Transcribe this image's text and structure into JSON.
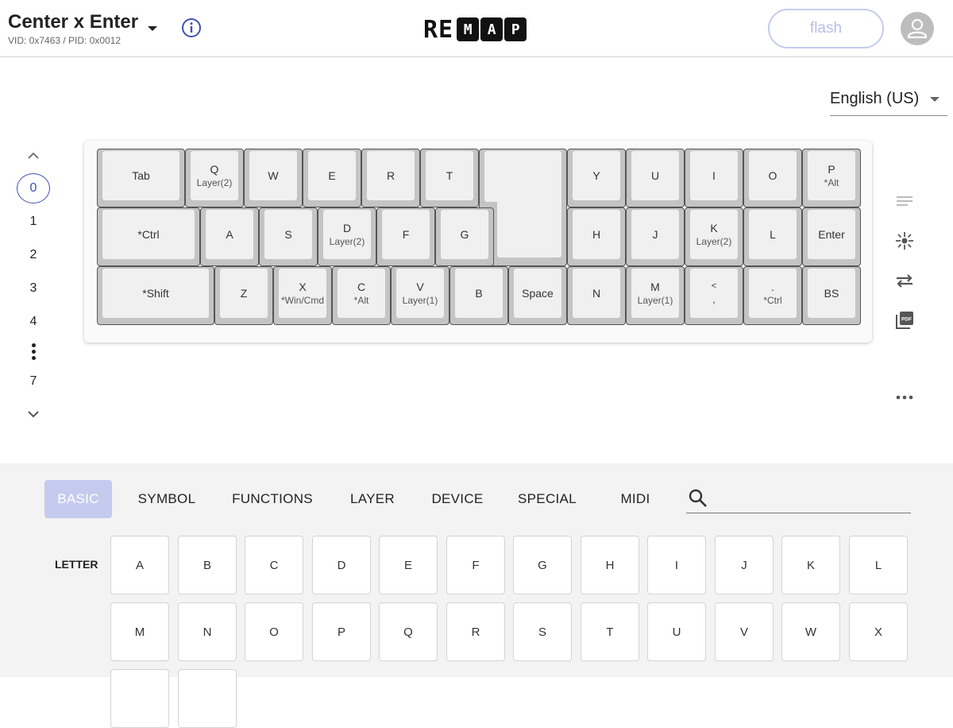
{
  "header": {
    "keyboard_name": "Center x Enter",
    "vid_pid": "VID: 0x7463 / PID: 0x0012",
    "logo_re": "RE",
    "logo_boxes": [
      "M",
      "A",
      "P"
    ],
    "flash_label": "flash"
  },
  "language": {
    "selected": "English (US)"
  },
  "layers": {
    "items": [
      "0",
      "1",
      "2",
      "3",
      "4",
      "7"
    ],
    "active": "0"
  },
  "keyboard": {
    "row1": [
      {
        "label": "Tab",
        "sub": ""
      },
      {
        "label": "Q",
        "sub": "Layer(2)"
      },
      {
        "label": "W",
        "sub": ""
      },
      {
        "label": "E",
        "sub": ""
      },
      {
        "label": "R",
        "sub": ""
      },
      {
        "label": "T",
        "sub": ""
      },
      {
        "label": "",
        "sub": ""
      },
      {
        "label": "Y",
        "sub": ""
      },
      {
        "label": "U",
        "sub": ""
      },
      {
        "label": "I",
        "sub": ""
      },
      {
        "label": "O",
        "sub": ""
      },
      {
        "label": "P",
        "sub": "*Alt"
      }
    ],
    "row2": [
      {
        "label": "*Ctrl",
        "sub": ""
      },
      {
        "label": "A",
        "sub": ""
      },
      {
        "label": "S",
        "sub": ""
      },
      {
        "label": "D",
        "sub": "Layer(2)"
      },
      {
        "label": "F",
        "sub": ""
      },
      {
        "label": "G",
        "sub": ""
      },
      {
        "label": "H",
        "sub": ""
      },
      {
        "label": "J",
        "sub": ""
      },
      {
        "label": "K",
        "sub": "Layer(2)"
      },
      {
        "label": "L",
        "sub": ""
      },
      {
        "label": "Enter",
        "sub": ""
      }
    ],
    "row3": [
      {
        "label": "*Shift",
        "sub": ""
      },
      {
        "label": "Z",
        "sub": ""
      },
      {
        "label": "X",
        "sub": "*Win/Cmd"
      },
      {
        "label": "C",
        "sub": "*Alt"
      },
      {
        "label": "V",
        "sub": "Layer(1)"
      },
      {
        "label": "B",
        "sub": ""
      },
      {
        "label": "Space",
        "sub": ""
      },
      {
        "label": "N",
        "sub": ""
      },
      {
        "label": "M",
        "sub": "Layer(1)"
      },
      {
        "label": "<",
        "sub": ","
      },
      {
        "label": ".",
        "sub": "*Ctrl"
      },
      {
        "label": "BS",
        "sub": ""
      }
    ]
  },
  "tabs": [
    "BASIC",
    "SYMBOL",
    "FUNCTIONS",
    "LAYER",
    "DEVICE",
    "SPECIAL",
    "MIDI"
  ],
  "active_tab": "BASIC",
  "search": {
    "placeholder": ""
  },
  "palette": {
    "section_label": "LETTER",
    "row1": [
      "A",
      "B",
      "C",
      "D",
      "E",
      "F",
      "G",
      "H",
      "I",
      "J",
      "K",
      "L"
    ],
    "row2": [
      "M",
      "N",
      "O",
      "P",
      "Q",
      "R",
      "S",
      "T",
      "U",
      "V",
      "W",
      "X"
    ]
  },
  "colors": {
    "accent": "#3f51b5",
    "tab_active_bg": "#c5cbee",
    "flash_border": "#c5cbee",
    "key_base": "#c4c4c4",
    "key_cap": "#f0f0f0"
  }
}
